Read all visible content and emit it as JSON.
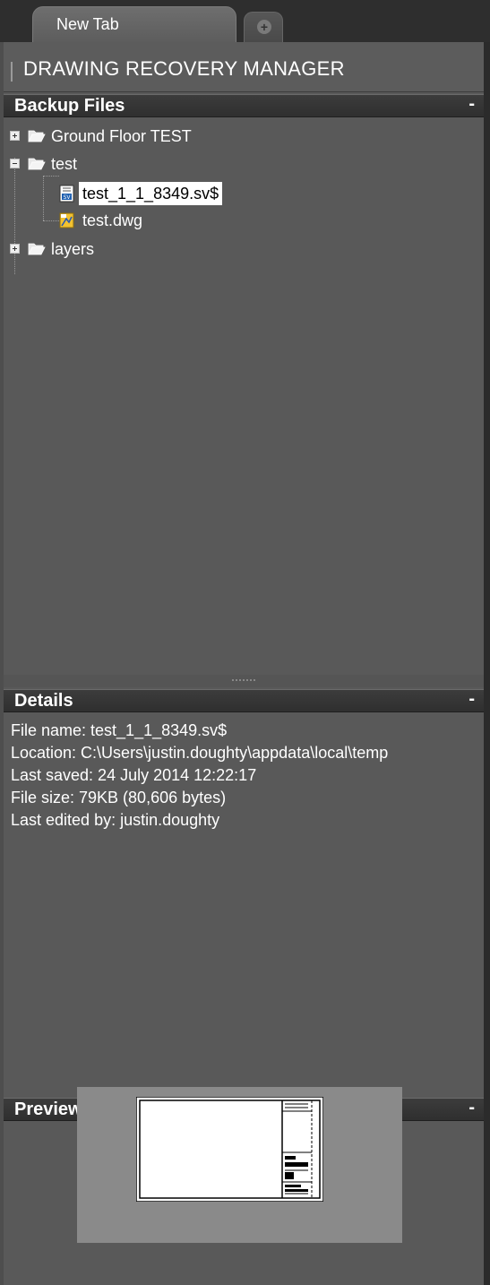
{
  "tabs": {
    "active_label": "New Tab",
    "new_tab_symbol": "+"
  },
  "app": {
    "title": "DRAWING RECOVERY MANAGER"
  },
  "backup": {
    "header": "Backup Files",
    "collapse_symbol": "-",
    "items": [
      {
        "label": "Ground Floor TEST",
        "type": "folder",
        "state": "collapsed"
      },
      {
        "label": "test",
        "type": "folder",
        "state": "expanded",
        "children": [
          {
            "label": "test_1_1_8349.sv$",
            "type": "sv$-file",
            "selected": true
          },
          {
            "label": "test.dwg",
            "type": "dwg-file",
            "selected": false
          }
        ]
      },
      {
        "label": "layers",
        "type": "folder",
        "state": "collapsed"
      }
    ]
  },
  "details": {
    "header": "Details",
    "collapse_symbol": "-",
    "lines": [
      "File name: test_1_1_8349.sv$",
      "Location: C:\\Users\\justin.doughty\\appdata\\local\\temp",
      "Last saved: 24 July 2014  12:22:17",
      "File size: 79KB (80,606 bytes)",
      "Last edited by: justin.doughty"
    ]
  },
  "preview": {
    "header": "Preview",
    "collapse_symbol": "-"
  },
  "colors": {
    "panel_bg": "#595959",
    "header_bg": "#333333",
    "selection_bg": "#ffffff",
    "text": "#ffffff"
  }
}
